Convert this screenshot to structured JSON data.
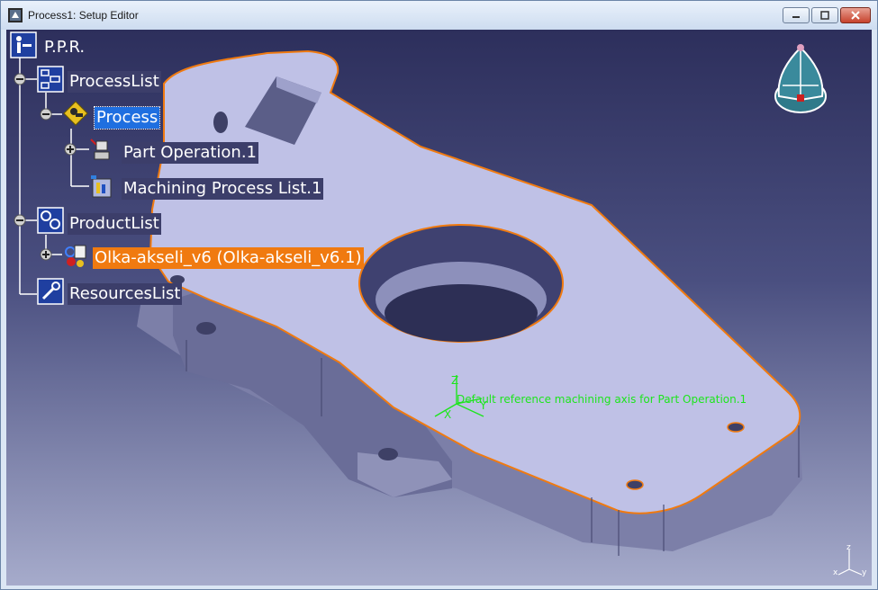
{
  "window": {
    "title": "Process1: Setup Editor",
    "icons": {
      "app": "catia-app-icon",
      "minimize": "minimize-icon",
      "maximize": "maximize-icon",
      "close": "close-icon"
    }
  },
  "tree": {
    "root": {
      "label": "P.P.R.",
      "icon": "ppr-icon"
    },
    "process_list": {
      "label": "ProcessList",
      "icon": "process-list-icon"
    },
    "process": {
      "label": "Process",
      "icon": "process-icon",
      "selected": true
    },
    "part_operation": {
      "label": "Part Operation.1",
      "icon": "part-operation-icon"
    },
    "machining_process_list": {
      "label": "Machining Process List.1",
      "icon": "machining-process-list-icon"
    },
    "product_list": {
      "label": "ProductList",
      "icon": "product-list-icon"
    },
    "product": {
      "label": "Olka-akseli_v6 (Olka-akseli_v6.1)",
      "icon": "product-icon",
      "highlighted": true
    },
    "resources_list": {
      "label": "ResourcesList",
      "icon": "resources-list-icon"
    }
  },
  "viewport": {
    "machining_axis_label": "Default reference machining axis for Part Operation.1",
    "axis_letters": {
      "x": "X",
      "y": "Y",
      "z": "Z"
    },
    "compass": {
      "label_x": "x",
      "label_y": "y",
      "label_z": "z"
    }
  },
  "colors": {
    "selection": "#1f6fe0",
    "highlight": "#f07a10",
    "part_edge": "#f07a10",
    "axis_green": "#1de51d"
  }
}
